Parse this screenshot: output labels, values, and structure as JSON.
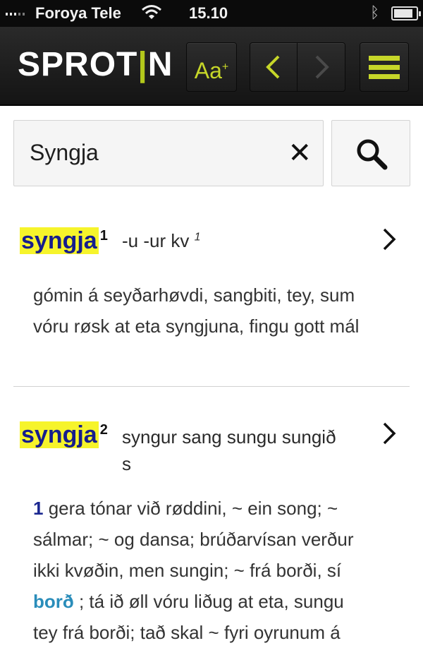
{
  "status_bar": {
    "carrier": "Foroya Tele",
    "time": "15.10"
  },
  "header": {
    "logo_text_a": "SPROT",
    "logo_text_b": "N",
    "font_button_label": "Aa",
    "font_button_sup": "+"
  },
  "search": {
    "value": "Syngja",
    "clear_glyph": "✕"
  },
  "entries": [
    {
      "headword": "syngja",
      "homograph": "1",
      "grammar": "-u -ur kv",
      "grammar_sup": "1",
      "definition_line1": "gómin á seyðarhøvdi, sangbiti, tey, sum",
      "definition_line2": "vóru røsk at eta syngjuna, fingu gott mál"
    },
    {
      "headword": "syngja",
      "homograph": "2",
      "grammar_line1": "syngur sang sungu sungið",
      "grammar_line2": "s",
      "sense_number": "1",
      "line1": "gera tónar við røddini, ~ ein song; ~",
      "line2": "sálmar; ~ og dansa; brúðarvísan verður",
      "line3": "ikki kvøðin, men sungin; ~ frá borði, sí",
      "xref": "borð",
      "line4_rest": " ; tá ið øll vóru liðug at eta, sungu",
      "line5": "tey frá borði; tað skal ~ fyri oyrunum á"
    }
  ],
  "colors": {
    "accent": "#c6d629",
    "headword": "#161d8c",
    "highlight": "#f6f42b",
    "xref": "#2a8dba"
  },
  "icons": {
    "font_size": "font-size-icon",
    "back": "chevron-left-icon",
    "forward": "chevron-right-icon",
    "menu": "hamburger-menu-icon",
    "clear": "close-icon",
    "search": "search-icon",
    "entry_open": "chevron-right-icon"
  }
}
